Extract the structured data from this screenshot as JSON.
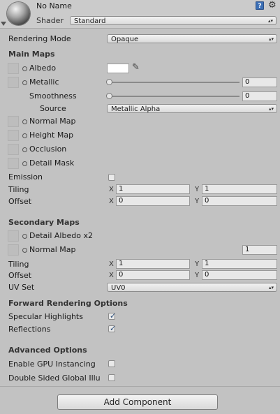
{
  "header": {
    "name": "No Name",
    "shader_label": "Shader",
    "shader_value": "Standard",
    "help_icon_text": "?",
    "gear_icon_text": "⚙"
  },
  "rendering_mode": {
    "label": "Rendering Mode",
    "value": "Opaque"
  },
  "main_maps": {
    "title": "Main Maps",
    "albedo": "Albedo",
    "metallic": "Metallic",
    "metallic_value": "0",
    "smoothness": "Smoothness",
    "smoothness_value": "0",
    "source": "Source",
    "source_value": "Metallic Alpha",
    "normal_map": "Normal Map",
    "height_map": "Height Map",
    "occlusion": "Occlusion",
    "detail_mask": "Detail Mask",
    "emission": "Emission",
    "tiling": "Tiling",
    "tiling_x": "1",
    "tiling_y": "1",
    "offset": "Offset",
    "offset_x": "0",
    "offset_y": "0"
  },
  "secondary_maps": {
    "title": "Secondary Maps",
    "detail_albedo": "Detail Albedo x2",
    "normal_map": "Normal Map",
    "normal_value": "1",
    "tiling": "Tiling",
    "tiling_x": "1",
    "tiling_y": "1",
    "offset": "Offset",
    "offset_x": "0",
    "offset_y": "0",
    "uv_set": "UV Set",
    "uv_set_value": "UV0"
  },
  "forward_rendering": {
    "title": "Forward Rendering Options",
    "specular_highlights": "Specular Highlights",
    "reflections": "Reflections"
  },
  "advanced": {
    "title": "Advanced Options",
    "gpu_instancing": "Enable GPU Instancing",
    "double_sided": "Double Sided Global Illu"
  },
  "axis": {
    "x": "X",
    "y": "Y"
  },
  "add_component": "Add Component",
  "checkmark": "✓",
  "dropdown_arrow": "▴▾",
  "eyedropper": "✎"
}
